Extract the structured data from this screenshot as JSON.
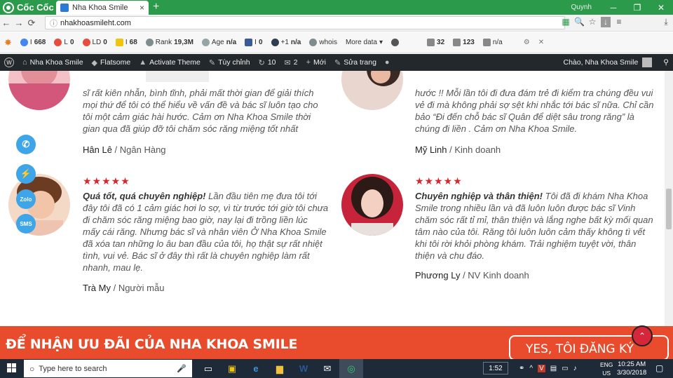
{
  "browser": {
    "brand": "Cốc Cốc",
    "tab_title": "Nha Khoa Smile",
    "tab_close": "×",
    "new_tab": "+",
    "user": "Quynh",
    "url": "nhakhoasmileht.com"
  },
  "seobar": {
    "items": [
      {
        "label": "I",
        "value": "668"
      },
      {
        "label": "L",
        "value": "0"
      },
      {
        "label": "LD",
        "value": "0"
      },
      {
        "label": "I",
        "value": "68"
      },
      {
        "label": "Rank",
        "value": "19,3M"
      },
      {
        "label": "Age",
        "value": "n/a"
      },
      {
        "label": "I",
        "value": "0"
      },
      {
        "label": "+1",
        "value": "n/a"
      },
      {
        "label": "whois",
        "value": ""
      },
      {
        "label": "More data",
        "value": "▾"
      },
      {
        "label": "",
        "value": "32"
      },
      {
        "label": "",
        "value": "123"
      },
      {
        "label": "",
        "value": "n/a"
      }
    ]
  },
  "wpbar": {
    "items": [
      {
        "icon": "W",
        "label": ""
      },
      {
        "icon": "⌂",
        "label": "Nha Khoa Smile"
      },
      {
        "icon": "◆",
        "label": "Flatsome"
      },
      {
        "icon": "▲",
        "label": "Activate Theme"
      },
      {
        "icon": "✎",
        "label": "Tùy chỉnh"
      },
      {
        "icon": "↻",
        "label": "10"
      },
      {
        "icon": "✉",
        "label": "2"
      },
      {
        "icon": "+",
        "label": "Mới"
      },
      {
        "icon": "✎",
        "label": "Sửa trang"
      },
      {
        "icon": "●",
        "label": ""
      }
    ],
    "greeting": "Chào, Nha Khoa Smile"
  },
  "reviews": [
    {
      "quote_lines": [
        "sĩ rất kiên nhẫn, bình tĩnh, phải mất thời gian để giải thích",
        "mọi thứ để tôi có thể hiểu về vấn đề và bác sĩ luôn tạo cho",
        "tôi một cảm giác hài hước. Cảm ơn Nha Khoa Smile thời",
        "gian qua đã giúp đỡ tôi chăm sóc răng miệng tốt nhất"
      ],
      "name": "Hân Lê",
      "role": "Ngân Hàng"
    },
    {
      "quote_lines": [
        "hước !! Mỗi lần tôi đi đưa đám trẻ đi kiểm tra chúng đều vui",
        "vẻ đi mà không phải sợ sệt khi nhắc tới bác sĩ nữa. Chỉ cần",
        "bảo “Đi đến chỗ bác sĩ Quân để diệt sâu trong răng” là",
        "chúng đi liền . Cảm ơn Nha Khoa Smile."
      ],
      "name": "Mỹ Linh",
      "role": "Kinh doanh"
    },
    {
      "stars": "★★★★★",
      "headline": "Quá tốt, quá chuyên nghiệp!",
      "quote_lines": [
        " Lần đầu tiên mẹ đưa tôi tới",
        "đây tôi đã có 1 cảm giác hơi lo sợ, vì từ trước tới giờ tôi chưa",
        "đi chăm sóc răng miệng bao giờ, nay lại đi trồng liền lúc",
        "mấy cái răng. Nhưng bác sĩ và nhân viên Ở Nha Khoa Smile",
        "đã xóa tan những lo âu ban đầu của tôi, họ thật sự rất nhiệt",
        "tình, vui vẻ. Bác sĩ ở đây thì rất là chuyên nghiệp làm rất",
        "nhanh, mau lẹ."
      ],
      "name": "Trà My",
      "role": "Người mẫu"
    },
    {
      "stars": "★★★★★",
      "headline": "Chuyên nghiệp và thân thiện!",
      "quote_lines": [
        " Tôi đã đi khám Nha Khoa",
        "Smile trong nhiều lần và đã luôn luôn được bác sĩ Vinh",
        "chăm sóc rất tỉ mỉ, thân thiện và lắng nghe bất kỳ mối quan",
        "tâm nào của tôi. Răng tôi luôn luôn cảm thấy không tì vết",
        "khi tôi rời khỏi phòng khám. Trải nghiệm tuyệt vời, thân",
        "thiện và chu đáo."
      ],
      "name": "Phương Ly",
      "role": "NV Kinh doanh"
    }
  ],
  "float_buttons": [
    "",
    "",
    "Zolo",
    "SMS"
  ],
  "cta": {
    "text": "ĐỂ NHẬN ƯU ĐÃI CỦA NHA KHOA SMILE",
    "button": "YES, TÔI ĐĂNG KÝ"
  },
  "taskbar": {
    "search_placeholder": "Type here to search",
    "timer": "1:52",
    "lang": "ENG",
    "region": "US",
    "time": "10:25 AM",
    "date": "3/30/2018"
  },
  "colors": {
    "accent": "#e84c2c",
    "stars": "#d8262d",
    "browser_green": "#2b9a4b"
  }
}
